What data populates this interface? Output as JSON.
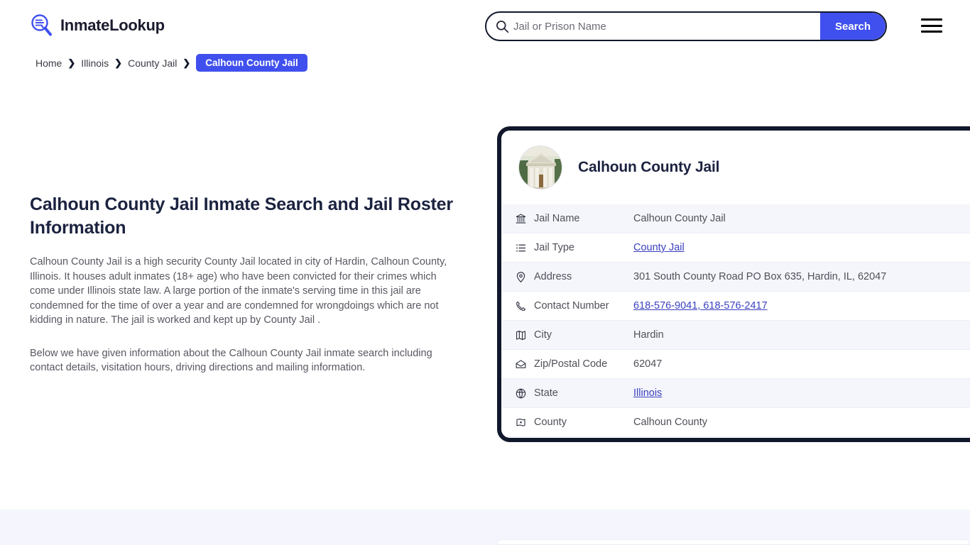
{
  "header": {
    "logo_icon": "magnifier-list-icon",
    "logo_text": "InmateLookup",
    "search": {
      "icon": "search-icon",
      "placeholder": "Jail or Prison Name",
      "value": "",
      "button_label": "Search"
    },
    "menu_icon": "hamburger-menu-icon"
  },
  "breadcrumb": {
    "items": [
      {
        "label": "Home",
        "current": false
      },
      {
        "label": "Illinois",
        "current": false
      },
      {
        "label": "County Jail",
        "current": false
      },
      {
        "label": "Calhoun County Jail",
        "current": true
      }
    ],
    "separator": "❯"
  },
  "main": {
    "title": "Calhoun County Jail Inmate Search and Jail Roster Information",
    "paragraph_1": "Calhoun County Jail is a high security County Jail located in city of Hardin, Calhoun County, Illinois. It houses adult inmates (18+ age) who have been convicted for their crimes which come under Illinois state law. A large portion of the inmate's serving time in this jail are condemned for the time of over a year and are condemned for wrongdoings which are not kidding in nature. The jail is worked and kept up by County Jail .",
    "paragraph_2": "Below we have given information about the Calhoun County Jail inmate search including contact details, visitation hours, driving directions and mailing information."
  },
  "info_card": {
    "thumbnail_icon": "courthouse-photo",
    "title": "Calhoun County Jail",
    "rows": [
      {
        "icon": "bank-icon",
        "label": "Jail Name",
        "value": "Calhoun County Jail",
        "link": false
      },
      {
        "icon": "list-icon",
        "label": "Jail Type",
        "value": "County Jail",
        "link": true
      },
      {
        "icon": "map-pin-icon",
        "label": "Address",
        "value": "301 South County Road PO Box 635, Hardin, IL, 62047",
        "link": false
      },
      {
        "icon": "phone-icon",
        "label": "Contact Number",
        "value": "618-576-9041, 618-576-2417",
        "link": true
      },
      {
        "icon": "map-icon",
        "label": "City",
        "value": "Hardin",
        "link": false
      },
      {
        "icon": "envelope-icon",
        "label": "Zip/Postal Code",
        "value": "62047",
        "link": false
      },
      {
        "icon": "globe-icon",
        "label": "State",
        "value": "Illinois",
        "link": true
      },
      {
        "icon": "flag-map-icon",
        "label": "County",
        "value": "Calhoun County",
        "link": false
      }
    ]
  },
  "colors": {
    "accent_blue": "#4050ee",
    "dark_navy": "#12182b",
    "link_blue": "#3a3fbf",
    "row_alt": "#f5f6fc",
    "band_bg": "#f5f6fd"
  }
}
